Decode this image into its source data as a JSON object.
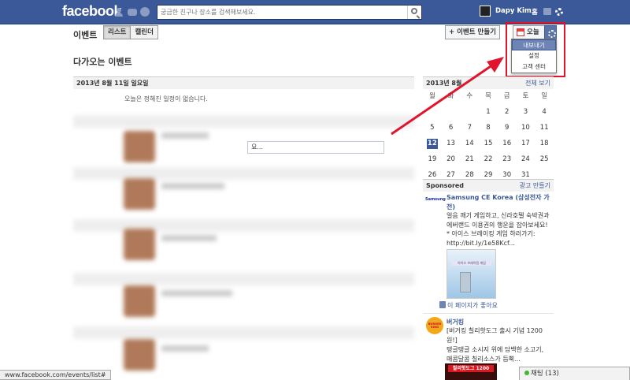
{
  "topbar": {
    "logo": "facebook",
    "search_placeholder": "궁금한 친구나 장소를 검색해보세요.",
    "user_name": "Dapy Kim",
    "home": "홈"
  },
  "header": {
    "title": "이벤트",
    "tabs": [
      {
        "label": "리스트"
      },
      {
        "label": "캘린더"
      }
    ],
    "create_event": "+ 이벤트 만들기",
    "today": "오늘"
  },
  "dropdown": {
    "items": [
      {
        "label": "내보내기"
      },
      {
        "label": "설정"
      },
      {
        "label": "고객 센터"
      }
    ]
  },
  "main": {
    "section_title": "다가오는 이벤트",
    "date_header": "2013년 8월 11일 일요일",
    "empty_message": "오늘은 정해진 일정이 없습니다.",
    "input_text": "요..."
  },
  "calendar": {
    "month": "2013년 8월",
    "full_view": "전체 보기",
    "weekdays": [
      "월",
      "화",
      "수",
      "목",
      "금",
      "토",
      "일"
    ],
    "weeks": [
      [
        "",
        "",
        "",
        "1",
        "2",
        "3",
        "4"
      ],
      [
        "5",
        "6",
        "7",
        "8",
        "9",
        "10",
        "11"
      ],
      [
        "12",
        "13",
        "14",
        "15",
        "16",
        "17",
        "18"
      ],
      [
        "19",
        "20",
        "21",
        "22",
        "23",
        "24",
        "25"
      ],
      [
        "26",
        "27",
        "28",
        "29",
        "30",
        "31",
        ""
      ]
    ],
    "today": "12"
  },
  "sponsored": {
    "label": "Sponsored",
    "create_ad": "광고 만들기",
    "ads": [
      {
        "logo": "Samsung",
        "title": "Samsung CE Korea (삼성전자 가전)",
        "body": "얼음 깨기 게임하고, 신라호텔 숙박권과\n에버랜드 이용권의 행운을 잡아보세요!\n* 아이스 브레이킹 게임 하러가기:\nhttp://bit.ly/1e58Kcf...",
        "image_text": "아이스 브레이킹 게임",
        "like": "이 페이지가 좋아요"
      },
      {
        "logo": "BURGER KING",
        "title": "버거킹",
        "subtitle": "[버거킹 칠리핫도그 출시 기념 1200원!]",
        "body": "탱글탱글 소시지 위에 담백한 소고기,\n매콤달콤 칠리소스가 듬뿍...",
        "image_text": "칠리핫도그 1200"
      }
    ]
  },
  "status_bar": "www.facebook.com/events/list#",
  "chat": "채팅 (13)"
}
